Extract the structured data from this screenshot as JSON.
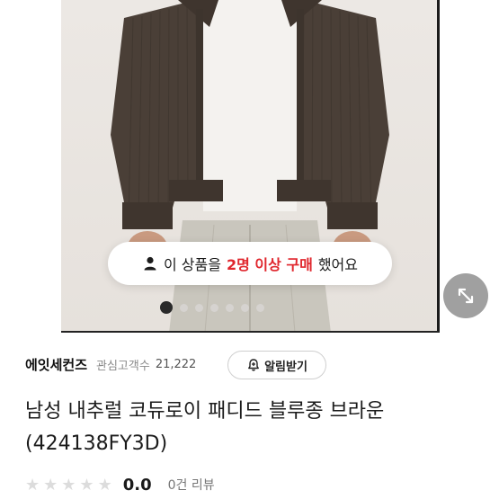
{
  "purchase_banner": {
    "text_before": "이 상품을",
    "highlight": "2명 이상 구매",
    "text_after": "했어요",
    "icon": "person-icon"
  },
  "carousel": {
    "total_dots": 7,
    "active_index": 0
  },
  "expand_button": {
    "icon": "expand-arrows-icon"
  },
  "brand": {
    "name": "에잇세컨즈",
    "favorites_label": "관심고객수",
    "favorites_count": "21,222"
  },
  "alert_button": {
    "label": "알림받기",
    "icon": "bell-plus-icon"
  },
  "product": {
    "title": "남성 내추럴 코듀로이 패디드 블루종 브라운 (424138FY3D)"
  },
  "rating": {
    "value": "0.0",
    "stars_filled": 0,
    "stars_total": 5,
    "review_count": "0건 리뷰"
  },
  "colors": {
    "accent_red": "#e0262d",
    "jacket_brown": "#4a3f37"
  }
}
